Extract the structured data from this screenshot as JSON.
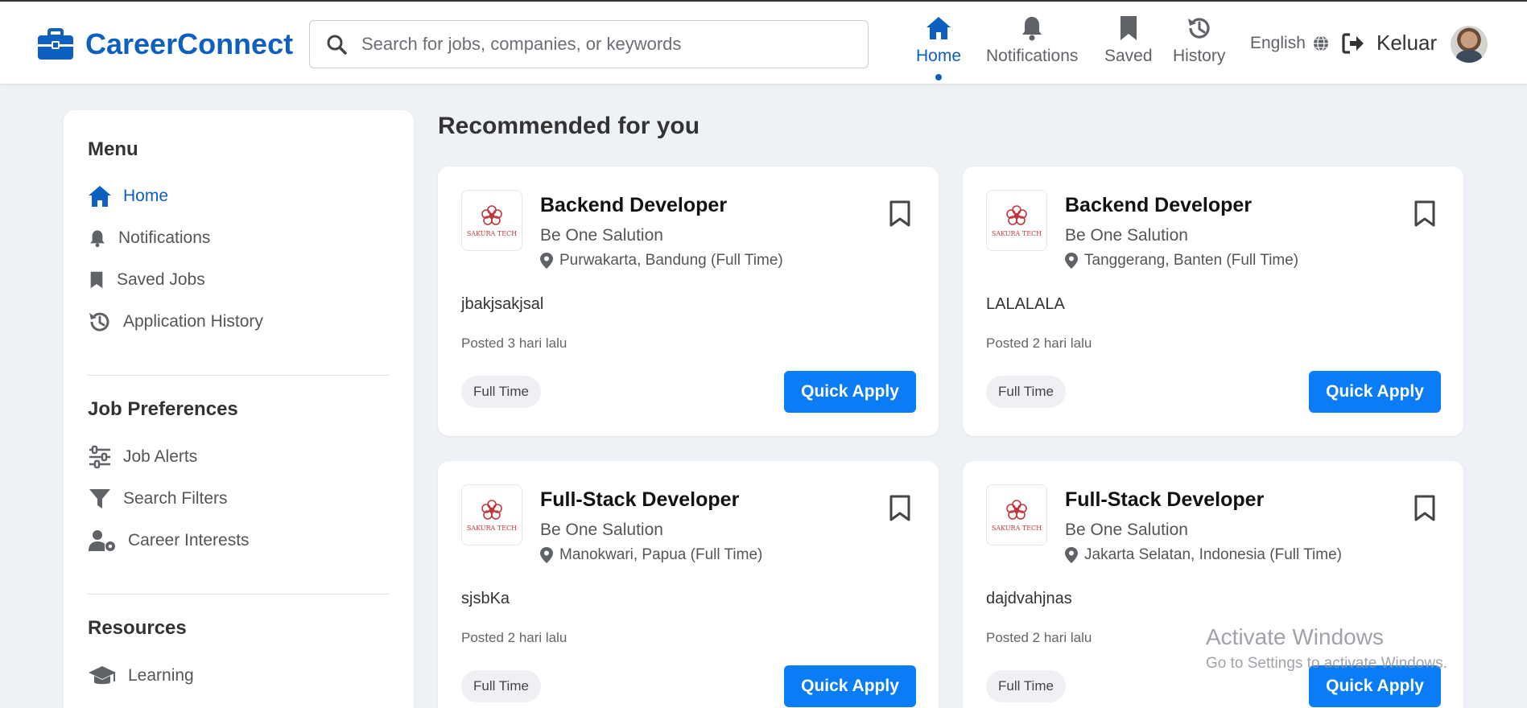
{
  "app": {
    "brand": "CareerConnect"
  },
  "search": {
    "placeholder": "Search for jobs, companies, or keywords"
  },
  "nav": {
    "home": "Home",
    "notifications": "Notifications",
    "saved": "Saved",
    "history": "History"
  },
  "header": {
    "language": "English",
    "logout": "Keluar"
  },
  "sidebar": {
    "menu_title": "Menu",
    "menu_items": [
      "Home",
      "Notifications",
      "Saved Jobs",
      "Application History"
    ],
    "prefs_title": "Job Preferences",
    "prefs_items": [
      "Job Alerts",
      "Search Filters",
      "Career Interests"
    ],
    "resources_title": "Resources",
    "resources_items": [
      "Learning"
    ]
  },
  "main": {
    "title": "Recommended for you",
    "jobs": [
      {
        "title": "Backend Developer",
        "company": "Be One Salution",
        "location": "Purwakarta, Bandung (Full Time)",
        "description": "jbakjsakjsal",
        "posted": "Posted 3 hari lalu",
        "tag": "Full Time",
        "apply": "Quick Apply",
        "logo_text": "SAKURA TECH"
      },
      {
        "title": "Backend Developer",
        "company": "Be One Salution",
        "location": "Tanggerang, Banten (Full Time)",
        "description": "LALALALA",
        "posted": "Posted 2 hari lalu",
        "tag": "Full Time",
        "apply": "Quick Apply",
        "logo_text": "SAKURA TECH"
      },
      {
        "title": "Full-Stack Developer",
        "company": "Be One Salution",
        "location": "Manokwari, Papua (Full Time)",
        "description": "sjsbKa",
        "posted": "Posted 2 hari lalu",
        "tag": "Full Time",
        "apply": "Quick Apply",
        "logo_text": "SAKURA TECH"
      },
      {
        "title": "Full-Stack Developer",
        "company": "Be One Salution",
        "location": "Jakarta Selatan, Indonesia (Full Time)",
        "description": "dajdvahjnas",
        "posted": "Posted 2 hari lalu",
        "tag": "Full Time",
        "apply": "Quick Apply",
        "logo_text": "SAKURA TECH"
      }
    ]
  },
  "watermark": {
    "line1": "Activate Windows",
    "line2": "Go to Settings to activate Windows."
  },
  "colors": {
    "brand": "#0d5fc0",
    "apply_button": "#0a7cf5",
    "background": "#eef2f6"
  }
}
